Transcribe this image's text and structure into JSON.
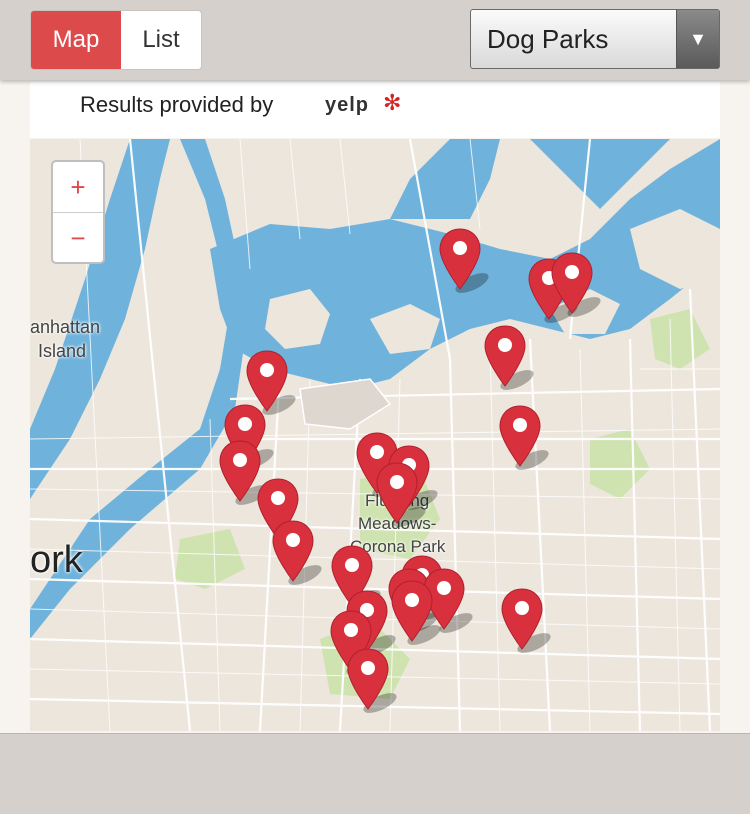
{
  "toggle": {
    "map_label": "Map",
    "list_label": "List",
    "active": "Map"
  },
  "category_select": {
    "selected": "Dog Parks"
  },
  "credit": {
    "text": "Results provided by",
    "logo": "yelp"
  },
  "zoom": {
    "in_label": "+",
    "out_label": "−"
  },
  "map": {
    "labels": {
      "manhattan_1": "anhattan",
      "manhattan_2": "Island",
      "york": "ork",
      "park_1": "Flushing",
      "park_2": "Meadows-",
      "park_3": "Corona Park"
    },
    "markers": [
      {
        "name": "dog-park-marker"
      },
      {
        "name": "dog-park-marker"
      },
      {
        "name": "dog-park-marker"
      },
      {
        "name": "dog-park-marker"
      },
      {
        "name": "dog-park-marker"
      },
      {
        "name": "dog-park-marker"
      },
      {
        "name": "dog-park-marker"
      },
      {
        "name": "dog-park-marker"
      },
      {
        "name": "dog-park-marker"
      },
      {
        "name": "dog-park-marker"
      },
      {
        "name": "dog-park-marker"
      },
      {
        "name": "dog-park-marker"
      },
      {
        "name": "dog-park-marker"
      },
      {
        "name": "dog-park-marker"
      },
      {
        "name": "dog-park-marker"
      },
      {
        "name": "dog-park-marker"
      },
      {
        "name": "dog-park-marker"
      },
      {
        "name": "dog-park-marker"
      },
      {
        "name": "dog-park-marker"
      },
      {
        "name": "dog-park-marker"
      },
      {
        "name": "dog-park-marker"
      },
      {
        "name": "dog-park-marker"
      }
    ],
    "colors": {
      "water": "#6fb3dc",
      "land": "#ede6dc",
      "park": "#cfe3b0",
      "marker": "#d9303e"
    }
  }
}
